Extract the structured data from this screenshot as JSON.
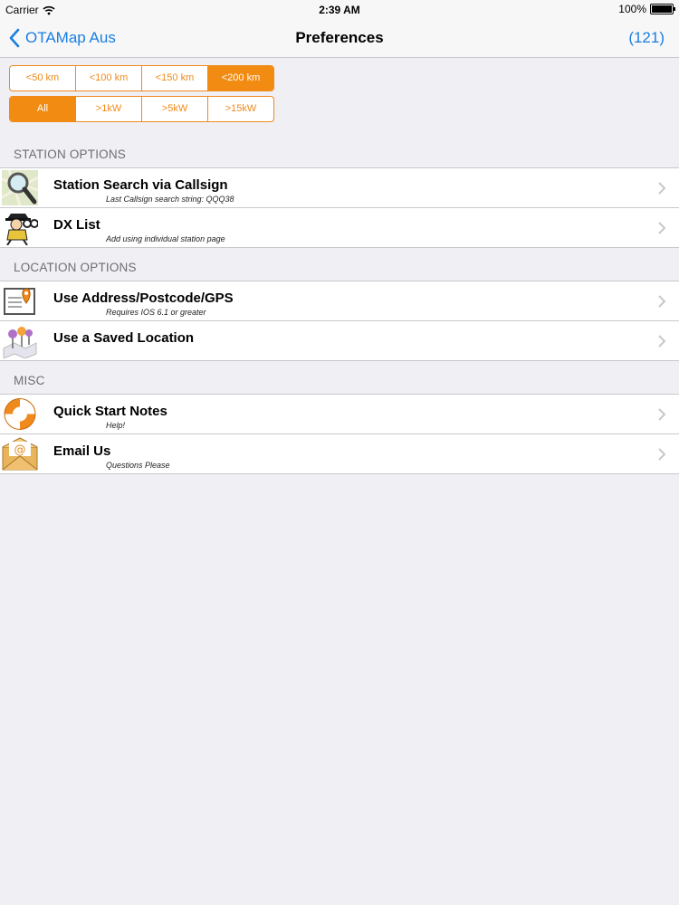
{
  "status_bar": {
    "carrier": "Carrier",
    "time": "2:39 AM",
    "battery": "100%"
  },
  "nav": {
    "back_label": "OTAMap Aus",
    "title": "Preferences",
    "count": "(121)"
  },
  "distance_filter": {
    "options": [
      "<50 km",
      "<100 km",
      "<150 km",
      "<200 km"
    ],
    "selected": "<200 km"
  },
  "power_filter": {
    "options": [
      "All",
      ">1kW",
      ">5kW",
      ">15kW"
    ],
    "selected": "All"
  },
  "sections": [
    {
      "header": "STATION OPTIONS",
      "rows": [
        {
          "title": "Station Search via Callsign",
          "subtitle": "Last Callsign search string: QQQ38",
          "icon": "magnifier-map-icon"
        },
        {
          "title": "DX List",
          "subtitle": "Add using individual station page",
          "icon": "spy-binoculars-icon"
        }
      ]
    },
    {
      "header": "LOCATION OPTIONS",
      "rows": [
        {
          "title": "Use Address/Postcode/GPS",
          "subtitle": "Requires IOS 6.1 or greater",
          "icon": "address-pin-icon"
        },
        {
          "title": "Use a Saved Location",
          "subtitle": "",
          "icon": "map-pins-icon"
        }
      ]
    },
    {
      "header": "MISC",
      "rows": [
        {
          "title": "Quick Start Notes",
          "subtitle": "Help!",
          "icon": "lifebuoy-icon"
        },
        {
          "title": "Email Us",
          "subtitle": "Questions Please",
          "icon": "envelope-icon"
        }
      ]
    }
  ],
  "colors": {
    "accent_orange": "#f28b11",
    "link_blue": "#1a7ee3",
    "background": "#efeff4"
  }
}
